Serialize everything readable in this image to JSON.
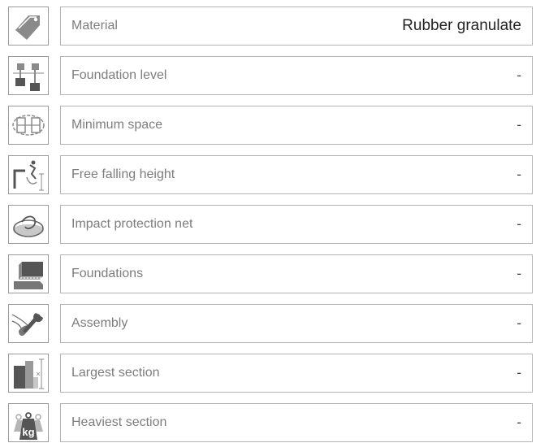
{
  "rows": [
    {
      "icon": "price-tag-icon",
      "label": "Material",
      "value": "Rubber granulate"
    },
    {
      "icon": "foundation-level-icon",
      "label": "Foundation level",
      "value": "-"
    },
    {
      "icon": "minimum-space-icon",
      "label": "Minimum space",
      "value": "-"
    },
    {
      "icon": "free-fall-icon",
      "label": "Free falling height",
      "value": "-"
    },
    {
      "icon": "net-icon",
      "label": "Impact protection net",
      "value": "-"
    },
    {
      "icon": "foundation-block-icon",
      "label": "Foundations",
      "value": "-"
    },
    {
      "icon": "wrench-hand-icon",
      "label": "Assembly",
      "value": "-"
    },
    {
      "icon": "section-size-icon",
      "label": "Largest section",
      "value": "-"
    },
    {
      "icon": "weight-kg-icon",
      "label": "Heaviest section",
      "value": "-"
    }
  ],
  "icon_text": {
    "kg": "kg"
  },
  "colors": {
    "icon_gray": "#8a8a8a",
    "border": "#b4b4b4",
    "label": "#7d7d7d",
    "value": "#222222"
  }
}
